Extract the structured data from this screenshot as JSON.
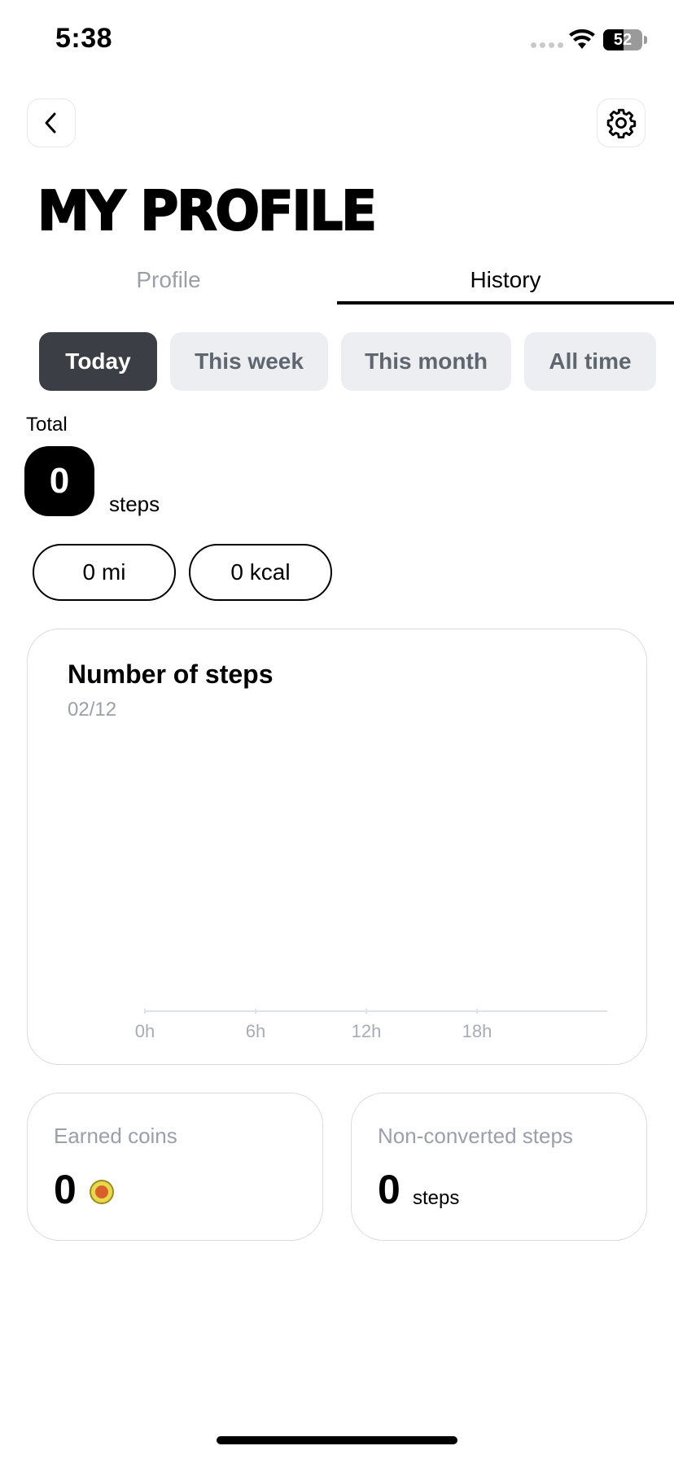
{
  "status_bar": {
    "time": "5:38",
    "battery_level": "52",
    "battery_fraction": 0.52
  },
  "header": {
    "title": "MY PROFILE"
  },
  "tabs": [
    {
      "label": "Profile",
      "active": false
    },
    {
      "label": "History",
      "active": true
    }
  ],
  "periods": [
    {
      "label": "Today",
      "active": true
    },
    {
      "label": "This week",
      "active": false
    },
    {
      "label": "This month",
      "active": false
    },
    {
      "label": "All time",
      "active": false
    }
  ],
  "summary": {
    "total_label": "Total",
    "total_value": "0",
    "total_unit": "steps",
    "distance": "0 mi",
    "calories": "0 kcal"
  },
  "chart_data": {
    "type": "bar",
    "title": "Number of steps",
    "subtitle": "02/12",
    "x_ticks": [
      "0h",
      "6h",
      "12h",
      "18h"
    ],
    "values": []
  },
  "stats": {
    "coins": {
      "label": "Earned coins",
      "value": "0"
    },
    "non_converted": {
      "label": "Non-converted steps",
      "value": "0",
      "unit": "steps"
    }
  },
  "colors": {
    "accent_dark": "#3b3e44",
    "muted_text": "#9aa0a8",
    "chip_bg": "#eceef1"
  }
}
